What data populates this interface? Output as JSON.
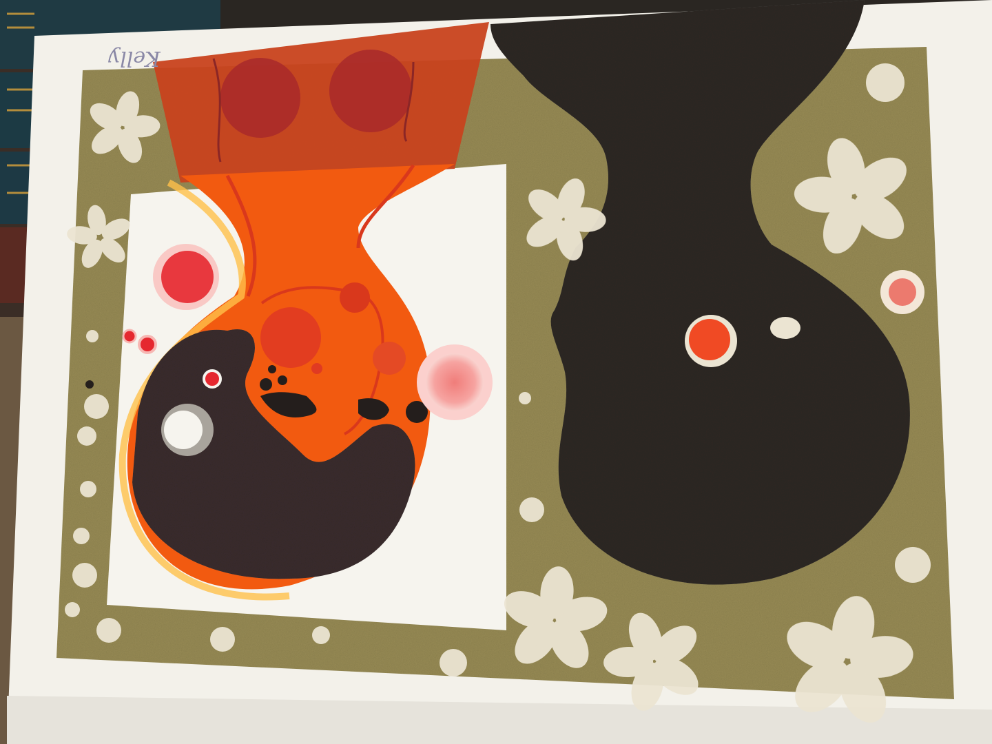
{
  "photo": {
    "subject": "",
    "signature_text": "Kelly"
  },
  "colors": {
    "paper": "#f3f1ea",
    "border": "#968a54",
    "inner_panel": "#f6f4ee",
    "orange": "#f25a10",
    "red_orange": "#d9381c",
    "dark_figure": "#3a2c2e",
    "black_head": "#2e2923",
    "flower": "#ebe4d2",
    "red_dot": "#e5282f",
    "pink_dot": "#ef8d8b"
  }
}
